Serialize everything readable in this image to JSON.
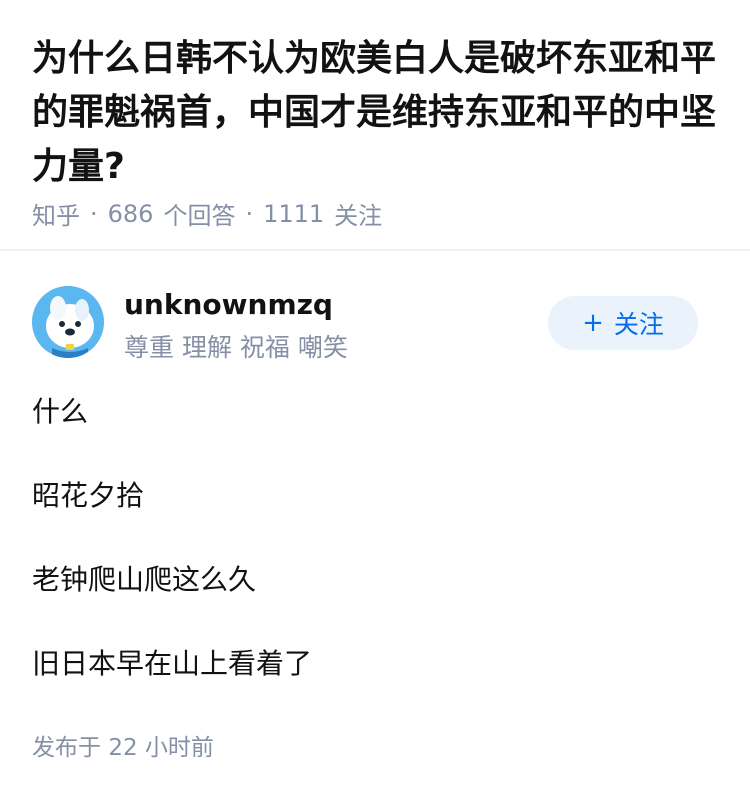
{
  "question": {
    "title": "为什么日韩不认为欧美白人是破坏东亚和平的罪魁祸首，中国才是维持东亚和平的中坚力量?",
    "source": "知乎",
    "separator": "·",
    "answer_count": "686",
    "answer_label": "个回答",
    "follower_count": "1111",
    "follower_label": "关注"
  },
  "answer": {
    "author_name": "unknownmzq",
    "author_bio": "尊重 理解 祝福 嘲笑",
    "follow_plus": "+",
    "follow_label": "关注",
    "paragraphs": [
      "什么",
      "昭花夕拾",
      "老钟爬山爬这么久",
      "旧日本早在山上看着了"
    ],
    "publish_prefix": "发布于",
    "publish_time": "22 小时前"
  },
  "colors": {
    "text_primary": "#121212",
    "text_secondary": "#8590a6",
    "accent_blue": "#056de8",
    "follow_bg": "#eaf2fb",
    "avatar_bg": "#5bb7ef"
  },
  "icons": {
    "avatar": "cartoon-dog-avatar",
    "follow": "plus-icon"
  }
}
